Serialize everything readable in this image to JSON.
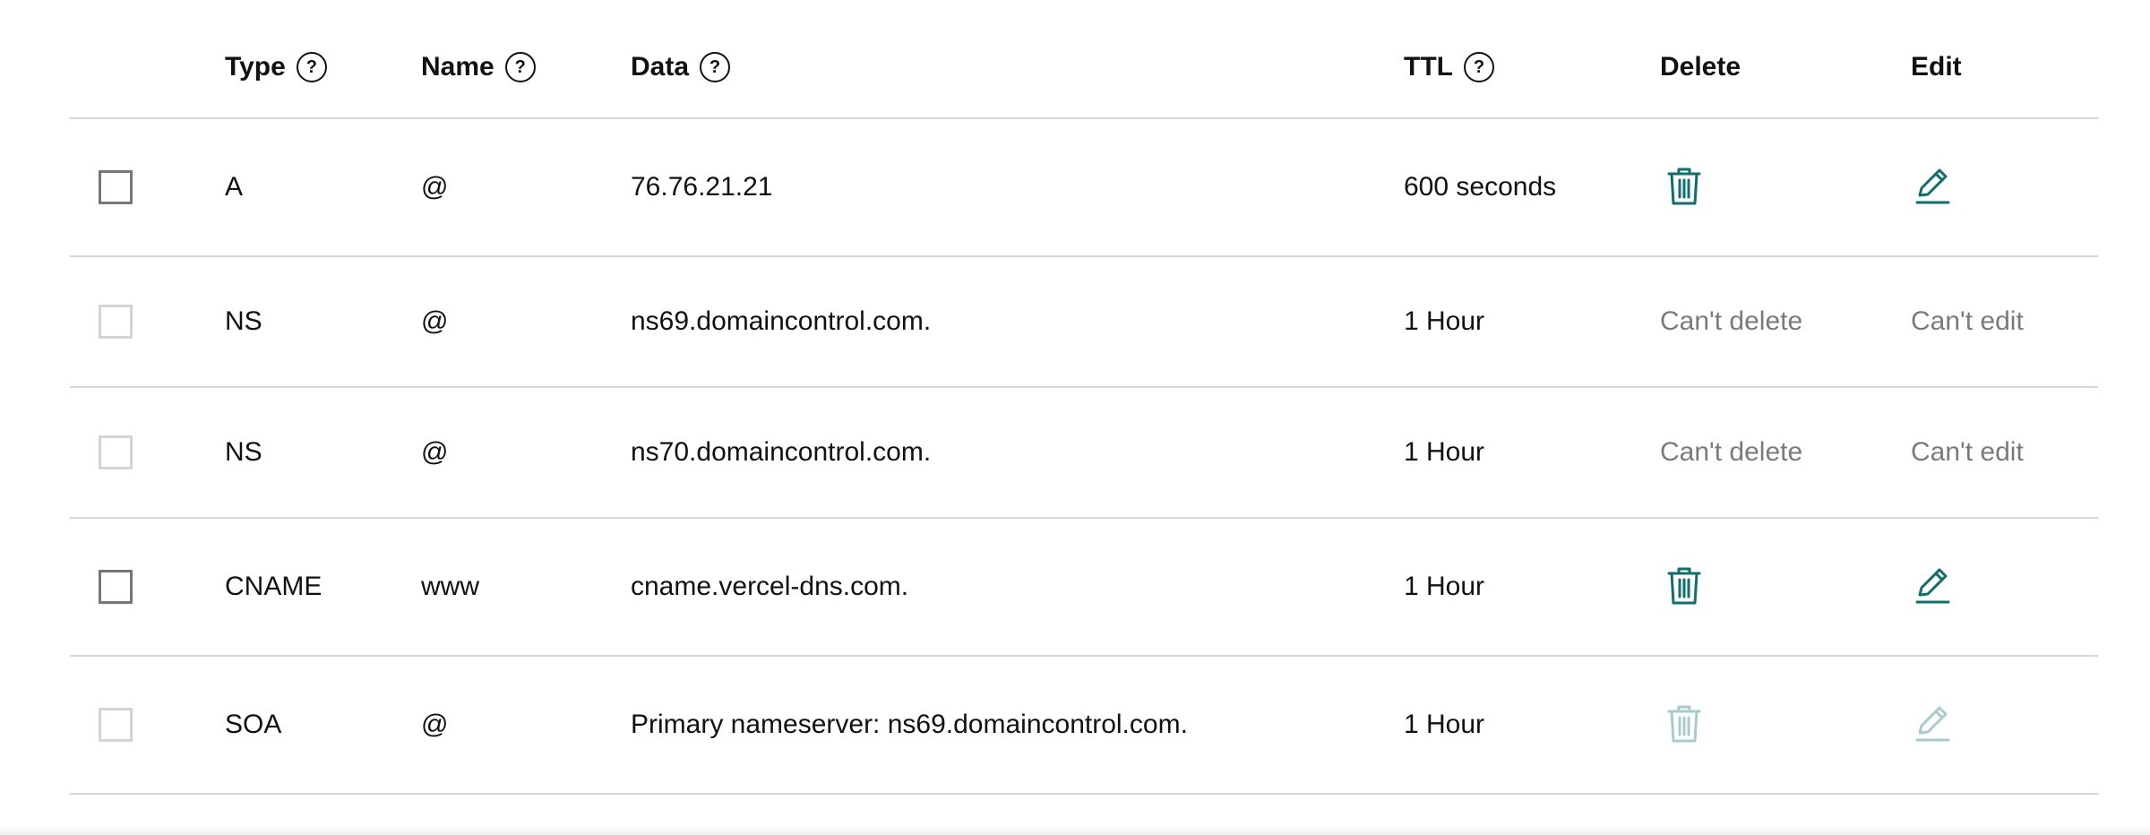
{
  "table": {
    "headers": {
      "type": "Type",
      "name": "Name",
      "data": "Data",
      "ttl": "TTL",
      "delete": "Delete",
      "edit": "Edit",
      "help_glyph": "?"
    },
    "records": [
      {
        "type": "A",
        "name": "@",
        "data": "76.76.21.21",
        "ttl": "600 seconds",
        "deletable": true,
        "editable": true,
        "checkbox_enabled": true
      },
      {
        "type": "NS",
        "name": "@",
        "data": "ns69.domaincontrol.com.",
        "ttl": "1 Hour",
        "delete_text": "Can't delete",
        "edit_text": "Can't edit",
        "deletable": false,
        "editable": false,
        "checkbox_enabled": false
      },
      {
        "type": "NS",
        "name": "@",
        "data": "ns70.domaincontrol.com.",
        "ttl": "1 Hour",
        "delete_text": "Can't delete",
        "edit_text": "Can't edit",
        "deletable": false,
        "editable": false,
        "checkbox_enabled": false
      },
      {
        "type": "CNAME",
        "name": "www",
        "data": "cname.vercel-dns.com.",
        "ttl": "1 Hour",
        "deletable": true,
        "editable": true,
        "checkbox_enabled": true
      },
      {
        "type": "SOA",
        "name": "@",
        "data": "Primary nameserver: ns69.domaincontrol.com.",
        "ttl": "1 Hour",
        "deletable": false,
        "editable": false,
        "checkbox_enabled": false,
        "icons_disabled": true
      }
    ]
  },
  "colors": {
    "accent": "#0f6e6e",
    "accent_disabled": "#a6cccc",
    "muted_text": "#7a7a7a",
    "divider": "#d6d6d6"
  },
  "icons": {
    "delete": "trash-icon",
    "edit": "pencil-icon",
    "help": "help-circle-icon"
  }
}
